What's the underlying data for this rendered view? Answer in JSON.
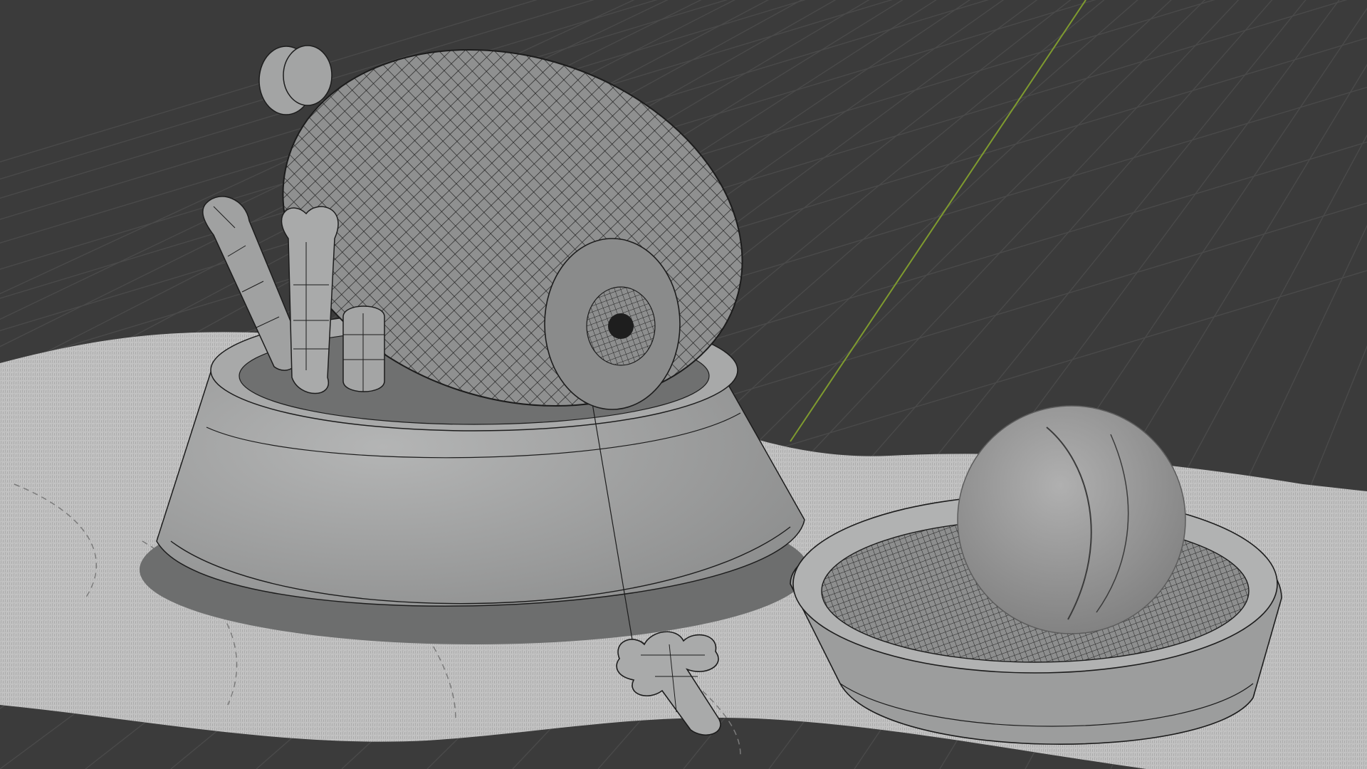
{
  "viewport": {
    "shading": "solid-wireframe-overlay",
    "background_color": "#3b3b3b",
    "grid_color": "#4a4a4a",
    "y_axis_color": "#7f9b2f",
    "mesh_fill_color": "#9a9b9b",
    "wire_color": "#1c1c1c",
    "fur_color": "#c6c6c6"
  },
  "scene_objects": [
    "fur-rug",
    "food-bowl",
    "ham",
    "bone",
    "sausage",
    "small-sausage",
    "dog-biscuit",
    "water-dish",
    "tennis-ball"
  ]
}
